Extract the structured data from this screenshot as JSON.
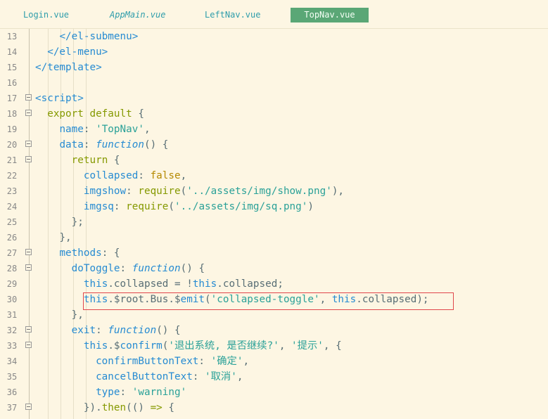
{
  "tabs": [
    {
      "label": "Login.vue",
      "active": false
    },
    {
      "label": "AppMain.vue",
      "active": false
    },
    {
      "label": "LeftNav.vue",
      "active": false
    },
    {
      "label": "TopNav.vue",
      "active": true
    }
  ],
  "colors": {
    "background": "#fdf6e3",
    "active_tab": "#5aa776",
    "highlight_border": "#e0474c"
  },
  "lines": [
    {
      "n": "13",
      "fold": false,
      "tokens": [
        [
          "pun",
          "    "
        ],
        [
          "tag",
          "</el-submenu>"
        ]
      ]
    },
    {
      "n": "14",
      "fold": false,
      "tokens": [
        [
          "pun",
          "  "
        ],
        [
          "tag",
          "</el-menu>"
        ]
      ]
    },
    {
      "n": "15",
      "fold": false,
      "tokens": [
        [
          "tag",
          "</template>"
        ]
      ]
    },
    {
      "n": "16",
      "fold": false,
      "tokens": []
    },
    {
      "n": "17",
      "fold": true,
      "tokens": [
        [
          "tag",
          "<script>"
        ]
      ]
    },
    {
      "n": "18",
      "fold": true,
      "tokens": [
        [
          "pun",
          "  "
        ],
        [
          "kw",
          "export default"
        ],
        [
          "pun",
          " {"
        ]
      ]
    },
    {
      "n": "19",
      "fold": false,
      "tokens": [
        [
          "pun",
          "    "
        ],
        [
          "key",
          "name"
        ],
        [
          "pun",
          ": "
        ],
        [
          "str",
          "'TopNav'"
        ],
        [
          "pun",
          ","
        ]
      ]
    },
    {
      "n": "20",
      "fold": true,
      "tokens": [
        [
          "pun",
          "    "
        ],
        [
          "key",
          "data"
        ],
        [
          "pun",
          ": "
        ],
        [
          "fn",
          "function"
        ],
        [
          "pun",
          "() {"
        ]
      ]
    },
    {
      "n": "21",
      "fold": true,
      "tokens": [
        [
          "pun",
          "      "
        ],
        [
          "kw",
          "return"
        ],
        [
          "pun",
          " {"
        ]
      ]
    },
    {
      "n": "22",
      "fold": false,
      "tokens": [
        [
          "pun",
          "        "
        ],
        [
          "key",
          "collapsed"
        ],
        [
          "pun",
          ": "
        ],
        [
          "bool",
          "false"
        ],
        [
          "pun",
          ","
        ]
      ]
    },
    {
      "n": "23",
      "fold": false,
      "tokens": [
        [
          "pun",
          "        "
        ],
        [
          "key",
          "imgshow"
        ],
        [
          "pun",
          ": "
        ],
        [
          "kw",
          "require"
        ],
        [
          "pun",
          "("
        ],
        [
          "str",
          "'../assets/img/show.png'"
        ],
        [
          "pun",
          "),"
        ]
      ]
    },
    {
      "n": "24",
      "fold": false,
      "tokens": [
        [
          "pun",
          "        "
        ],
        [
          "key",
          "imgsq"
        ],
        [
          "pun",
          ": "
        ],
        [
          "kw",
          "require"
        ],
        [
          "pun",
          "("
        ],
        [
          "str",
          "'../assets/img/sq.png'"
        ],
        [
          "pun",
          ")"
        ]
      ]
    },
    {
      "n": "25",
      "fold": false,
      "tokens": [
        [
          "pun",
          "      };"
        ]
      ]
    },
    {
      "n": "26",
      "fold": false,
      "tokens": [
        [
          "pun",
          "    },"
        ]
      ]
    },
    {
      "n": "27",
      "fold": true,
      "tokens": [
        [
          "pun",
          "    "
        ],
        [
          "key",
          "methods"
        ],
        [
          "pun",
          ": {"
        ]
      ]
    },
    {
      "n": "28",
      "fold": true,
      "tokens": [
        [
          "pun",
          "      "
        ],
        [
          "key",
          "doToggle"
        ],
        [
          "pun",
          ": "
        ],
        [
          "fn",
          "function"
        ],
        [
          "pun",
          "() {"
        ]
      ]
    },
    {
      "n": "29",
      "fold": false,
      "tokens": [
        [
          "pun",
          "        "
        ],
        [
          "this",
          "this"
        ],
        [
          "pun",
          ".collapsed = !"
        ],
        [
          "this",
          "this"
        ],
        [
          "pun",
          ".collapsed;"
        ]
      ]
    },
    {
      "n": "30",
      "fold": false,
      "tokens": [
        [
          "pun",
          "        "
        ],
        [
          "this",
          "this"
        ],
        [
          "pun",
          ".$root.Bus.$"
        ],
        [
          "key",
          "emit"
        ],
        [
          "pun",
          "("
        ],
        [
          "str",
          "'collapsed-toggle'"
        ],
        [
          "pun",
          ", "
        ],
        [
          "this",
          "this"
        ],
        [
          "pun",
          ".collapsed);"
        ]
      ]
    },
    {
      "n": "31",
      "fold": false,
      "tokens": [
        [
          "pun",
          "      },"
        ]
      ]
    },
    {
      "n": "32",
      "fold": true,
      "tokens": [
        [
          "pun",
          "      "
        ],
        [
          "key",
          "exit"
        ],
        [
          "pun",
          ": "
        ],
        [
          "fn",
          "function"
        ],
        [
          "pun",
          "() {"
        ]
      ]
    },
    {
      "n": "33",
      "fold": true,
      "tokens": [
        [
          "pun",
          "        "
        ],
        [
          "this",
          "this"
        ],
        [
          "pun",
          ".$"
        ],
        [
          "key",
          "confirm"
        ],
        [
          "pun",
          "("
        ],
        [
          "str",
          "'退出系统, 是否继续?'"
        ],
        [
          "pun",
          ", "
        ],
        [
          "str",
          "'提示'"
        ],
        [
          "pun",
          ", {"
        ]
      ]
    },
    {
      "n": "34",
      "fold": false,
      "tokens": [
        [
          "pun",
          "          "
        ],
        [
          "key",
          "confirmButtonText"
        ],
        [
          "pun",
          ": "
        ],
        [
          "str",
          "'确定'"
        ],
        [
          "pun",
          ","
        ]
      ]
    },
    {
      "n": "35",
      "fold": false,
      "tokens": [
        [
          "pun",
          "          "
        ],
        [
          "key",
          "cancelButtonText"
        ],
        [
          "pun",
          ": "
        ],
        [
          "str",
          "'取消'"
        ],
        [
          "pun",
          ","
        ]
      ]
    },
    {
      "n": "36",
      "fold": false,
      "tokens": [
        [
          "pun",
          "          "
        ],
        [
          "key",
          "type"
        ],
        [
          "pun",
          ": "
        ],
        [
          "str",
          "'warning'"
        ]
      ]
    },
    {
      "n": "37",
      "fold": true,
      "tokens": [
        [
          "pun",
          "        })."
        ],
        [
          "kw",
          "then"
        ],
        [
          "pun",
          "(() "
        ],
        [
          "kw",
          "=>"
        ],
        [
          "pun",
          " {"
        ]
      ]
    }
  ]
}
